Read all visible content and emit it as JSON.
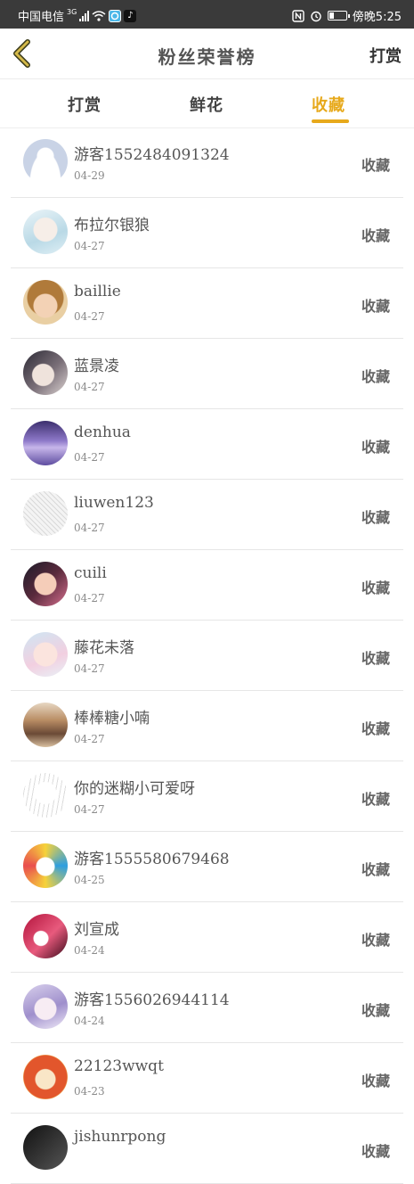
{
  "status_bar": {
    "carrier": "中国电信",
    "network": "3G",
    "time": "傍晚5:25",
    "battery_level": 0.3,
    "icons": [
      "signal-icon",
      "wifi-icon",
      "app-icon",
      "tiktok-icon",
      "nfc-icon",
      "alarm-icon",
      "battery-icon"
    ]
  },
  "header": {
    "title": "粉丝荣誉榜",
    "action_label": "打赏",
    "back_icon": "chevron-left-icon",
    "accent_color": "#e7a91b"
  },
  "tabs": [
    {
      "label": "打赏",
      "active": false
    },
    {
      "label": "鲜花",
      "active": false
    },
    {
      "label": "收藏",
      "active": true
    }
  ],
  "fans": [
    {
      "name": "游客1552484091324",
      "date": "04-29",
      "action": "收藏",
      "avatar": "default-avatar"
    },
    {
      "name": "布拉尔银狼",
      "date": "04-27",
      "action": "收藏",
      "avatar": "anime-avatar"
    },
    {
      "name": "baillie",
      "date": "04-27",
      "action": "收藏",
      "avatar": "anime-avatar"
    },
    {
      "name": "蓝景凌",
      "date": "04-27",
      "action": "收藏",
      "avatar": "anime-avatar"
    },
    {
      "name": "denhua",
      "date": "04-27",
      "action": "收藏",
      "avatar": "landscape-avatar"
    },
    {
      "name": "liuwen123",
      "date": "04-27",
      "action": "收藏",
      "avatar": "sketch-avatar"
    },
    {
      "name": "cuili",
      "date": "04-27",
      "action": "收藏",
      "avatar": "photo-avatar"
    },
    {
      "name": "藤花未落",
      "date": "04-27",
      "action": "收藏",
      "avatar": "anime-avatar"
    },
    {
      "name": "棒棒糖小喃",
      "date": "04-27",
      "action": "收藏",
      "avatar": "photo-avatar"
    },
    {
      "name": "你的迷糊小可爱呀",
      "date": "04-27",
      "action": "收藏",
      "avatar": "sketch-avatar"
    },
    {
      "name": "游客1555580679468",
      "date": "04-25",
      "action": "收藏",
      "avatar": "cartoon-avatar"
    },
    {
      "name": "刘宣成",
      "date": "04-24",
      "action": "收藏",
      "avatar": "cartoon-avatar"
    },
    {
      "name": "游客1556026944114",
      "date": "04-24",
      "action": "收藏",
      "avatar": "anime-avatar"
    },
    {
      "name": "22123wwqt",
      "date": "04-23",
      "action": "收藏",
      "avatar": "cartoon-avatar"
    },
    {
      "name": "jishunrpong",
      "date": "",
      "action": "收藏",
      "avatar": "photo-avatar"
    }
  ]
}
